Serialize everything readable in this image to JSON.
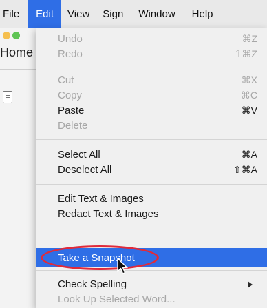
{
  "menubar": {
    "file": "File",
    "edit": "Edit",
    "view": "View",
    "sign": "Sign",
    "window": "Window",
    "help": "Help"
  },
  "background_window": {
    "title_fragment": "Home"
  },
  "edit_menu": {
    "undo": {
      "label": "Undo",
      "shortcut": "⌘Z"
    },
    "redo": {
      "label": "Redo",
      "shortcut": "⇧⌘Z"
    },
    "cut": {
      "label": "Cut",
      "shortcut": "⌘X"
    },
    "copy": {
      "label": "Copy",
      "shortcut": "⌘C"
    },
    "paste": {
      "label": "Paste",
      "shortcut": "⌘V"
    },
    "delete": {
      "label": "Delete"
    },
    "select_all": {
      "label": "Select All",
      "shortcut": "⌘A"
    },
    "deselect_all": {
      "label": "Deselect All",
      "shortcut": "⇧⌘A"
    },
    "edit_text_images": {
      "label": "Edit Text & Images"
    },
    "redact_text_images": {
      "label": "Redact Text & Images"
    },
    "take_snapshot": {
      "label": "Take a Snapshot"
    },
    "check_spelling": {
      "label": "Check Spelling"
    },
    "look_up": {
      "label": "Look Up Selected Word..."
    }
  },
  "colors": {
    "highlight": "#2f6ee6",
    "annotation_circle": "#e02a3a"
  }
}
